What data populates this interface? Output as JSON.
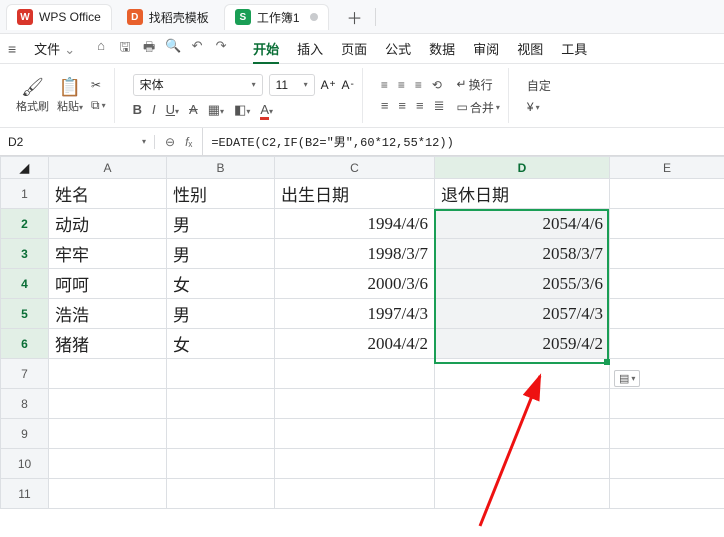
{
  "titlebar": {
    "app_tab": "WPS Office",
    "template_tab": "找稻壳模板",
    "workbook_tab": "工作簿1"
  },
  "menubar": {
    "file": "文件",
    "menus": [
      "开始",
      "插入",
      "页面",
      "公式",
      "数据",
      "审阅",
      "视图",
      "工具"
    ],
    "active_index": 0
  },
  "ribbon": {
    "format_painter": "格式刷",
    "paste": "粘贴",
    "font_name": "宋体",
    "font_size": "11",
    "wrap": "换行",
    "merge": "合并",
    "currency": "¥",
    "custom": "自定"
  },
  "fx": {
    "cell_ref": "D2",
    "formula": "=EDATE(C2,IF(B2=\"男\",60*12,55*12))"
  },
  "col_letters": [
    "A",
    "B",
    "C",
    "D",
    "E"
  ],
  "row_numbers": [
    "1",
    "2",
    "3",
    "4",
    "5",
    "6",
    "7",
    "8",
    "9",
    "10",
    "11"
  ],
  "head": {
    "name": "姓名",
    "sex": "性别",
    "birth": "出生日期",
    "retire": "退休日期"
  },
  "rows": [
    {
      "name": "动动",
      "sex": "男",
      "birth": "1994/4/6",
      "retire": "2054/4/6"
    },
    {
      "name": "牢牢",
      "sex": "男",
      "birth": "1998/3/7",
      "retire": "2058/3/7"
    },
    {
      "name": "呵呵",
      "sex": "女",
      "birth": "2000/3/6",
      "retire": "2055/3/6"
    },
    {
      "name": "浩浩",
      "sex": "男",
      "birth": "1997/4/3",
      "retire": "2057/4/3"
    },
    {
      "name": "猪猪",
      "sex": "女",
      "birth": "2004/4/2",
      "retire": "2059/4/2"
    }
  ]
}
